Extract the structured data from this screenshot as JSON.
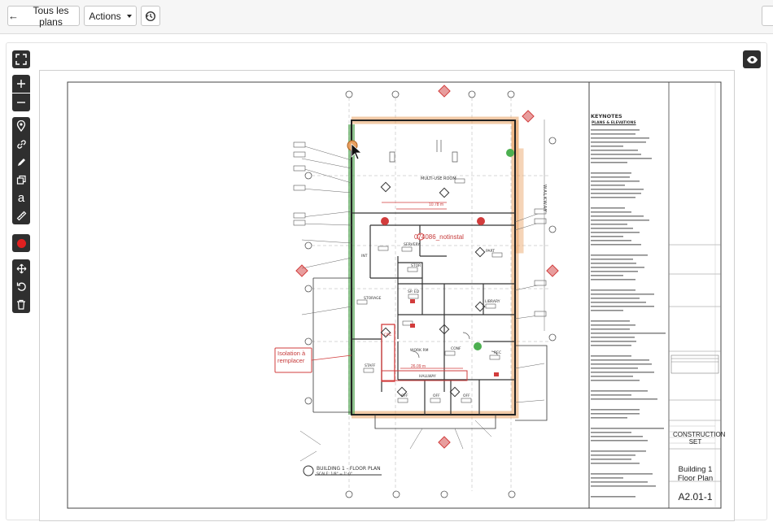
{
  "toolbar": {
    "back_label": "Tous les plans",
    "actions_label": "Actions",
    "history_icon": "history-icon"
  },
  "sidebar": {
    "tools": [
      {
        "name": "fullscreen-icon"
      },
      {
        "name": "zoom-in-icon"
      },
      {
        "name": "zoom-out-icon"
      },
      {
        "name": "pin-icon"
      },
      {
        "name": "link-icon"
      },
      {
        "name": "pencil-icon"
      },
      {
        "name": "copy-icon"
      },
      {
        "name": "text-icon",
        "glyph": "a"
      },
      {
        "name": "ruler-icon"
      },
      {
        "name": "color-icon",
        "color": "#e02020"
      },
      {
        "name": "move-icon"
      },
      {
        "name": "rotate-icon"
      },
      {
        "name": "trash-icon"
      }
    ]
  },
  "plan": {
    "annotation_label": "074086_notinstal",
    "note_text": "Isolation à remplacer",
    "dimension_1": "10.78 m",
    "dimension_2": "26.09 m",
    "rooms": [
      "MULTI-USE ROOM",
      "SERVERY",
      "PART",
      "STOR",
      "SP. ED",
      "LIBRARY",
      "CONF",
      "WORK RM",
      "REC",
      "STORAGE",
      "STAFF",
      "OFF",
      "OFF",
      "OFF",
      "HALLWAY",
      "INT",
      "CIRC"
    ],
    "walkway_label": "WALKWAY",
    "footer_title": "BUILDING 1 - FLOOR PLAN",
    "footer_scale": "SCALE: 1/8\" = 1'-0\""
  },
  "title_block": {
    "keynotes_title": "KEYNOTES",
    "plans_heading": "PLANS & ELEVATIONS",
    "project_name": "CONSTRUCTION SET",
    "sheet_title": "Building 1 Floor Plan",
    "sheet_number": "A2.01-1"
  },
  "colors": {
    "highlight_orange": "#e8a060",
    "highlight_green": "#5ca85c",
    "markup_red": "#d23c3c",
    "toolbar_dark": "#2f2f2f"
  }
}
